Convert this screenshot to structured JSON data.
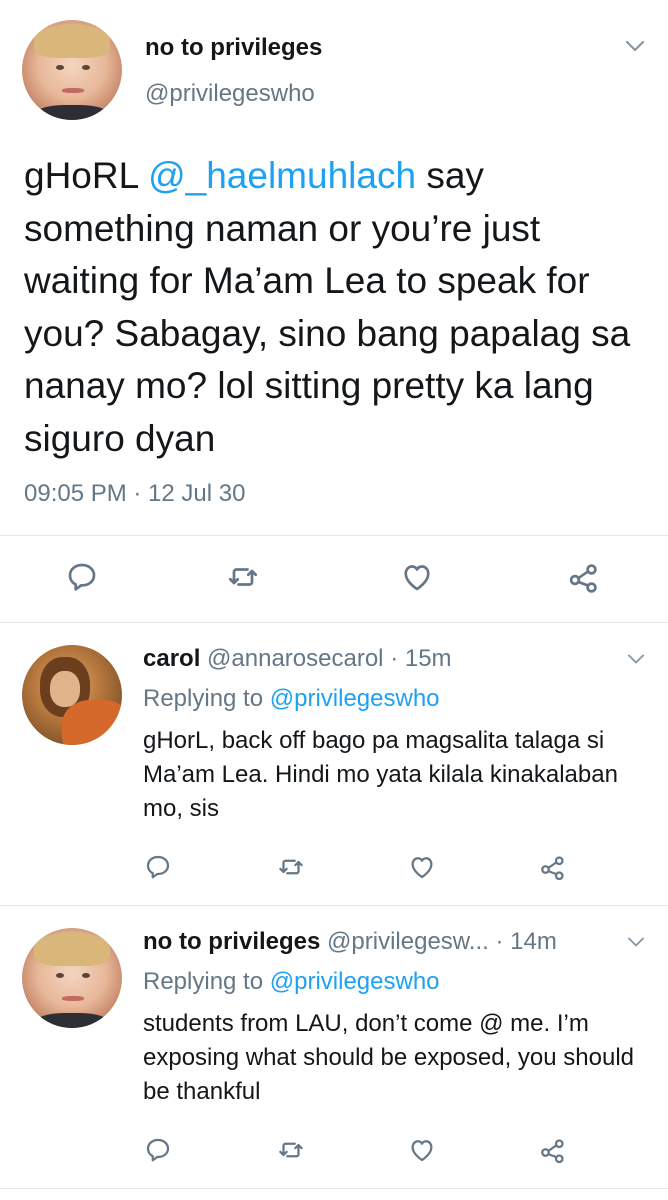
{
  "main_tweet": {
    "author_name": "no to privileges",
    "author_handle": "@privilegeswho",
    "text_segments": {
      "prefix": "gHoRL ",
      "mention": "@_haelmuhlach",
      "rest": " say something naman or you’re just waiting for Ma’am Lea to speak for you? Sabagay, sino bang papalag sa nanay mo? lol sitting pretty ka lang siguro dyan"
    },
    "timestamp": "09:05 PM · 12 Jul 30"
  },
  "replies": [
    {
      "author_name": "carol",
      "author_handle": "@annarosecarol",
      "time": "· 15m",
      "replying_label": "Replying to",
      "replying_to": "@privilegeswho",
      "text": "gHorL, back off bago pa magsalita talaga si Ma’am Lea. Hindi mo yata kilala kinakalaban mo, sis"
    },
    {
      "author_name": "no to privileges",
      "author_handle": "@privilegesw...",
      "time": "· 14m",
      "replying_label": "Replying to",
      "replying_to": "@privilegeswho",
      "text": "students from LAU, don’t come @ me. I’m exposing what should be exposed, you should be thankful"
    }
  ],
  "icons": {
    "reply": "reply-icon",
    "retweet": "retweet-icon",
    "like": "heart-icon",
    "share": "share-icon",
    "more": "chevron-down-icon"
  },
  "colors": {
    "link": "#1da1f2",
    "muted": "#657786",
    "text": "#14171a",
    "divider": "#e1e8ed"
  }
}
